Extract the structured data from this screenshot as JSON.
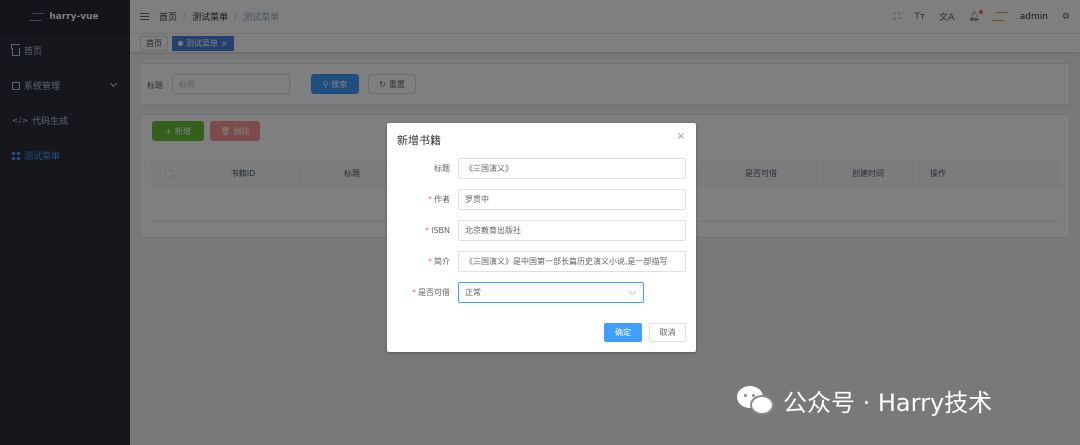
{
  "app": {
    "logo_text": "harry-vue"
  },
  "sidebar": {
    "items": [
      {
        "label": "首页",
        "icon": "home-icon"
      },
      {
        "label": "系统管理",
        "icon": "monitor-icon"
      },
      {
        "label": "代码生成",
        "icon": "code-icon"
      },
      {
        "label": "测试菜单",
        "icon": "grid-icon",
        "active": true
      }
    ]
  },
  "navbar": {
    "breadcrumb": [
      "首页",
      "测试菜单",
      "测试菜单"
    ],
    "separator": "/",
    "icons": [
      "fullscreen-icon",
      "font-size-icon",
      "translate-icon",
      "bell-icon"
    ],
    "size_icon_text": "Tт",
    "lang_icon_text": "文A",
    "user": "admin"
  },
  "tags": {
    "items": [
      "首页",
      "测试菜单"
    ],
    "close": "×"
  },
  "search": {
    "title_label": "标题",
    "title_placeholder": "标题",
    "search_button": "搜索",
    "reset_button": "重置"
  },
  "toolbar": {
    "add_button": "新增",
    "delete_button": "删除"
  },
  "table": {
    "columns": [
      "书籍ID",
      "标题",
      "是否可借",
      "创建时间",
      "操作"
    ]
  },
  "dialog": {
    "title": "新增书籍",
    "close": "×",
    "fields": [
      {
        "label": "标题",
        "required": false,
        "value": "《三国演义》"
      },
      {
        "label": "作者",
        "required": true,
        "value": "罗贯中"
      },
      {
        "label": "ISBN",
        "required": true,
        "value": "北京教育出版社"
      },
      {
        "label": "简介",
        "required": true,
        "value": "《三国演义》是中国第一部长篇历史演义小说,是一部描写"
      },
      {
        "label": "是否可借",
        "required": true,
        "value": "正常"
      }
    ],
    "required_mark": "*",
    "confirm_button": "确定",
    "cancel_button": "取消"
  },
  "watermark": {
    "text": "公众号 · Harry技术"
  },
  "colors": {
    "primary": "#409eff",
    "success": "#67c23a",
    "danger": "#f56c6c",
    "sidebar": "#2b2f3a"
  }
}
